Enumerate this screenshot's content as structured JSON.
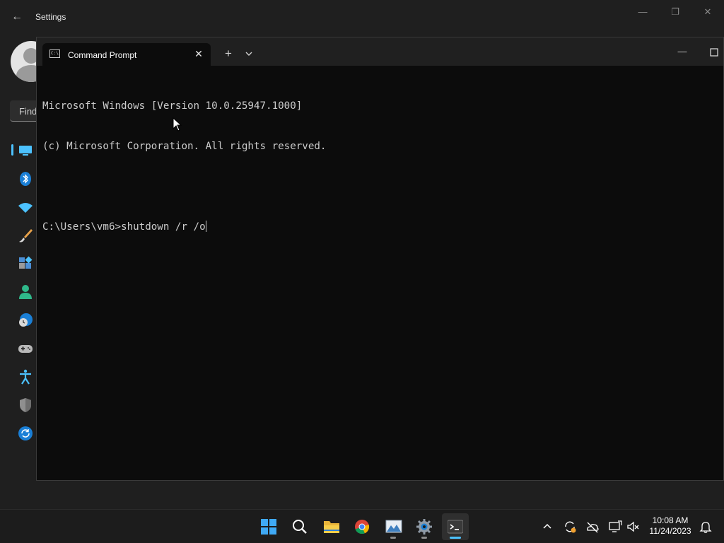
{
  "settings": {
    "title": "Settings",
    "search_placeholder": "Find",
    "nav_icons": [
      "system-icon",
      "bluetooth-icon",
      "wifi-icon",
      "personalization-icon",
      "apps-icon",
      "accounts-icon",
      "time-language-icon",
      "gaming-icon",
      "accessibility-icon",
      "privacy-security-icon",
      "windows-update-icon"
    ]
  },
  "terminal": {
    "tab_title": "Command Prompt",
    "console_lines": [
      "Microsoft Windows [Version 10.0.25947.1000]",
      "(c) Microsoft Corporation. All rights reserved.",
      "",
      "C:\\Users\\vm6>shutdown /r /o"
    ]
  },
  "taskbar": {
    "apps": [
      "start-icon",
      "search-icon",
      "file-explorer-icon",
      "chrome-icon",
      "photos-icon",
      "settings-icon",
      "terminal-icon"
    ],
    "clock": {
      "time": "10:08 AM",
      "date": "11/24/2023"
    }
  },
  "colors": {
    "accent": "#4cc2ff",
    "console_bg": "#0c0c0c",
    "console_text": "#cccccc"
  }
}
